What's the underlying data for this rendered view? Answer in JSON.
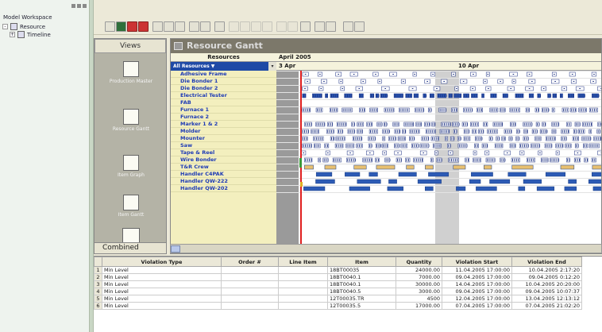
{
  "sidebar": {
    "title": "Model Workspace",
    "items": [
      {
        "label": "Resource",
        "expander": "-"
      },
      {
        "label": "Timeline",
        "expander": "+"
      }
    ]
  },
  "toolbar": {
    "buttons": [
      "layout",
      "gantt",
      "chart",
      "export",
      "zoom-in",
      "zoom-out",
      "zoom-fit",
      "tools",
      "filter",
      "pointer",
      "link",
      "cut",
      "copy",
      "paste",
      "undo",
      "redo",
      "grid",
      "sort",
      "schedule",
      "check",
      "info"
    ]
  },
  "views": {
    "header": "Views",
    "items": [
      {
        "label": "Production Master"
      },
      {
        "label": "Resource Gantt"
      },
      {
        "label": "Item Graph"
      },
      {
        "label": "Item Gantt"
      }
    ],
    "combined_label": "Combined"
  },
  "gantt": {
    "title": "Resource Gantt",
    "resources_header": "Resources",
    "selector": "All Resources ▼",
    "month": "April 2005",
    "weeks": [
      {
        "label": "3 Apr"
      },
      {
        "label": "10 Apr"
      }
    ],
    "resources": [
      "Adhesive Frame",
      "Die Bonder 1",
      "Die Bonder 2",
      "Electrical Tester",
      "FAB",
      "Furnace 1",
      "Furnace 2",
      "Marker 1 & 2",
      "Molder",
      "Mounter",
      "Saw",
      "Tape & Reel",
      "Wire Bonder",
      "T&R Crew",
      "Handler C4PAK",
      "Handler QW-222",
      "Handler QW-202"
    ]
  },
  "violations": {
    "columns": [
      "Violation Type",
      "Order #",
      "Line Item",
      "Item",
      "Quantity",
      "Violation Start",
      "Violation End"
    ],
    "rows": [
      {
        "idx": "1",
        "type": "Min Level",
        "order": "",
        "line": "",
        "item": "18BT00035",
        "qty": "24000.00",
        "start": "11.04.2005 17:00:00",
        "end": "10.04.2005 2:17:20"
      },
      {
        "idx": "2",
        "type": "Min Level",
        "order": "",
        "line": "",
        "item": "18BT0040.1",
        "qty": "7000.00",
        "start": "09.04.2005 17:00:00",
        "end": "09.04.2005 0:12:20"
      },
      {
        "idx": "3",
        "type": "Min Level",
        "order": "",
        "line": "",
        "item": "18BT0040.1",
        "qty": "30000.00",
        "start": "14.04.2005 17:00:00",
        "end": "10.04.2005 20:20:00"
      },
      {
        "idx": "4",
        "type": "Min Level",
        "order": "",
        "line": "",
        "item": "18BT0040.5",
        "qty": "3000.00",
        "start": "09.04.2005 17:00:00",
        "end": "09.04.2005 10:07:37"
      },
      {
        "idx": "5",
        "type": "Min Level",
        "order": "",
        "line": "",
        "item": "12T00035.TR",
        "qty": "4500",
        "start": "12.04.2005 17:00:00",
        "end": "13.04.2005 12:13:12"
      },
      {
        "idx": "6",
        "type": "Min Level",
        "order": "",
        "line": "",
        "item": "12T00035.5",
        "qty": "17000.00",
        "start": "07.04.2005 17:00:00",
        "end": "07.04.2005 21:02:20"
      }
    ]
  },
  "colors": {
    "bar_blue": "#2d5bb5",
    "selection": "#1f4aa6",
    "resource_bg": "#f3efbe",
    "shade": "#9a9a9a",
    "now_line": "#e02020",
    "green": "#3a9a3a"
  }
}
